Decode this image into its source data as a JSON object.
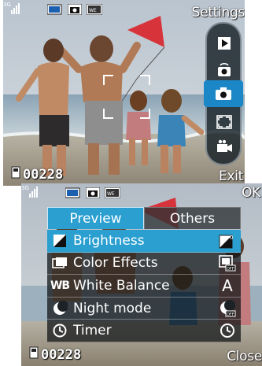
{
  "screen1": {
    "softkeys": {
      "top_right": "Settings",
      "bottom_right": "Exit"
    },
    "counter": "00228",
    "status_icons": [
      "signal-3g-icon",
      "battery-icon",
      "camera-mode-icon",
      "memory-card-icon"
    ],
    "toolbar": {
      "items": [
        "play-icon",
        "camera-switch-icon",
        "camera-icon",
        "fullscreen-icon",
        "video-camera-icon"
      ],
      "active_index": 2
    }
  },
  "screen2": {
    "softkeys": {
      "top_right": "OK",
      "bottom_right": "Close"
    },
    "counter": "00228",
    "tabs": [
      {
        "label": "Preview",
        "active": true
      },
      {
        "label": "Others",
        "active": false
      }
    ],
    "rows": [
      {
        "label": "Brightness",
        "icon": "brightness-icon",
        "value_icon": "brightness-zero-icon",
        "selected": true
      },
      {
        "label": "Color Effects",
        "icon": "color-effects-icon",
        "value_icon": "effects-off-icon",
        "selected": false
      },
      {
        "label": "White Balance",
        "lead_text": "WB",
        "icon": "white-balance-icon",
        "value_text": "A",
        "selected": false
      },
      {
        "label": "Night mode",
        "icon": "night-mode-icon",
        "value_icon": "night-off-icon",
        "selected": false
      },
      {
        "label": "Timer",
        "icon": "timer-icon",
        "value_icon": "timer-off-icon",
        "selected": false
      }
    ]
  },
  "colors": {
    "accent": "#2a9fd0",
    "toolbar_active": "#1b87c7"
  }
}
